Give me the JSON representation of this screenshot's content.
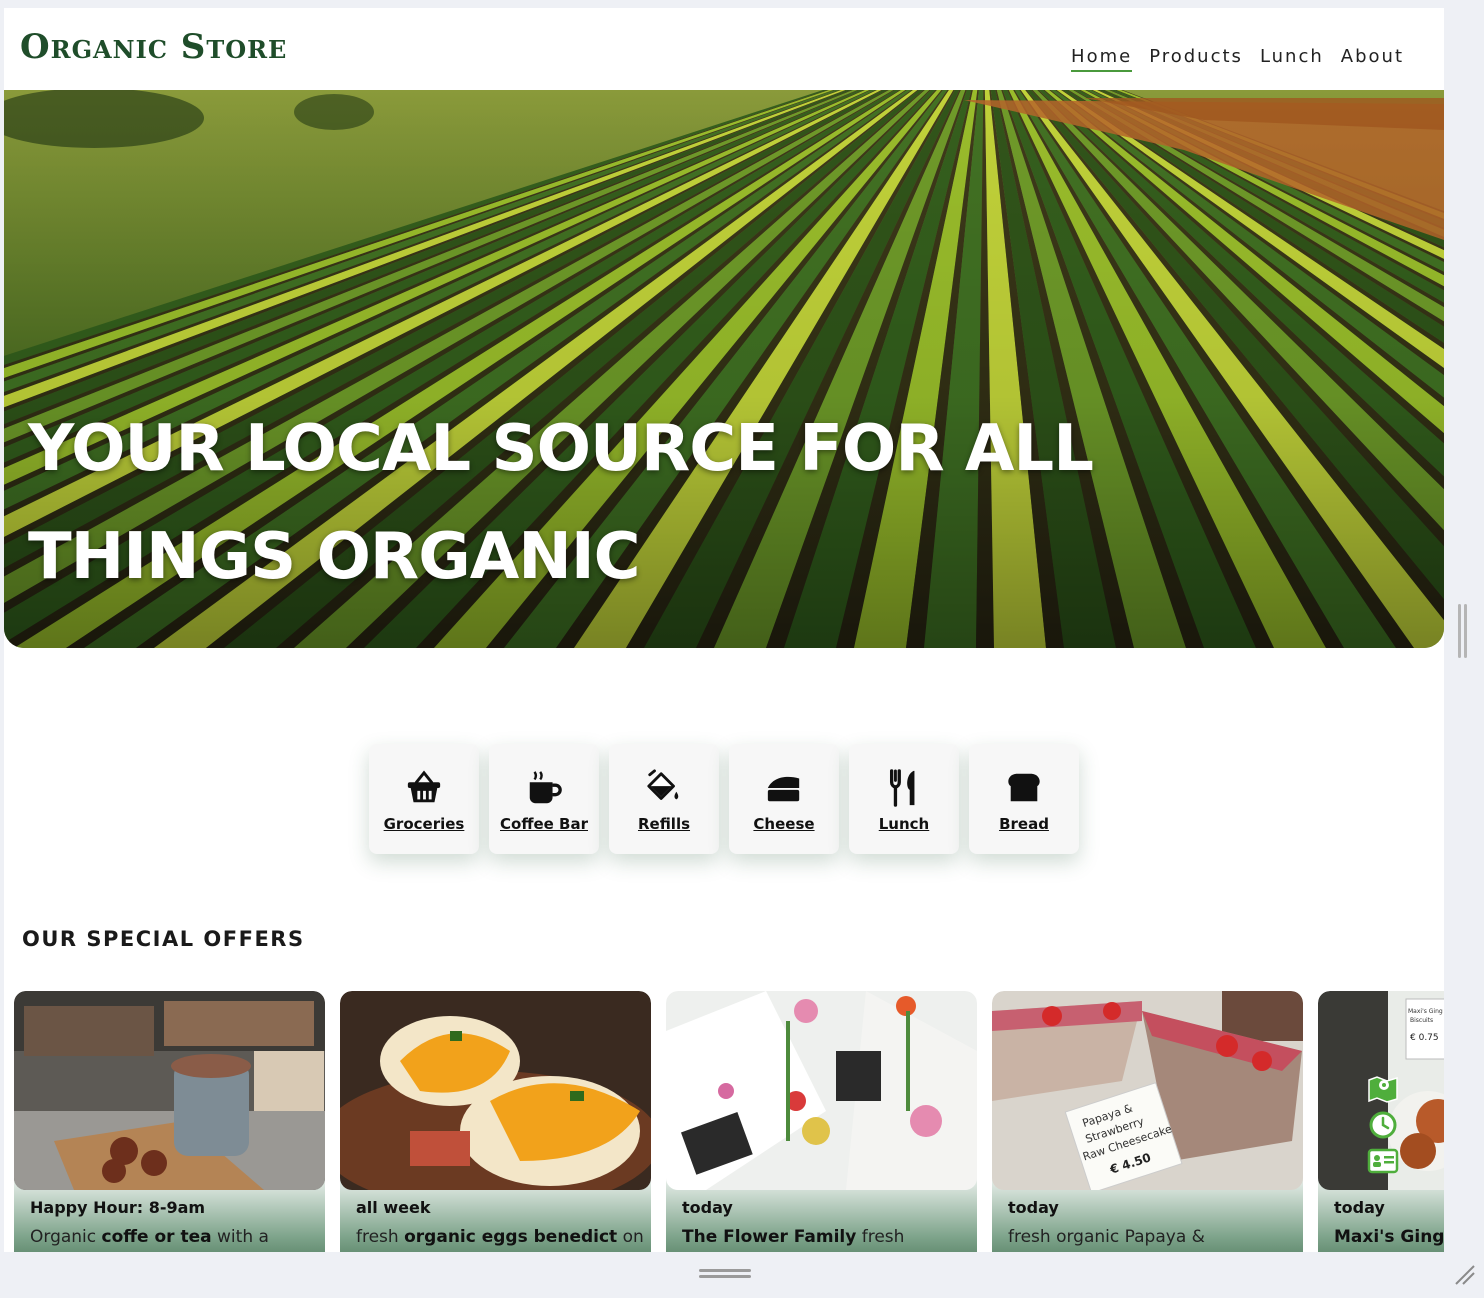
{
  "header": {
    "logo": "Organic Store",
    "nav": [
      "Home",
      "Products",
      "Lunch",
      "About"
    ],
    "active_nav": "Home"
  },
  "hero": {
    "title": "YOUR LOCAL SOURCE FOR ALL THINGS ORGANIC"
  },
  "categories": [
    {
      "label": "Groceries",
      "icon": "basket-icon"
    },
    {
      "label": "Coffee Bar",
      "icon": "coffee-cup-icon"
    },
    {
      "label": "Refills",
      "icon": "fill-bucket-icon"
    },
    {
      "label": "Cheese",
      "icon": "cheese-icon"
    },
    {
      "label": "Lunch",
      "icon": "utensils-icon"
    },
    {
      "label": "Bread",
      "icon": "bread-icon"
    }
  ],
  "offers_title": "OUR SPECIAL OFFERS",
  "offers": [
    {
      "when": "Happy Hour: 8-9am",
      "pre": "Organic ",
      "bold": "coffe or tea",
      "post": " with a"
    },
    {
      "when": "all week",
      "pre": "fresh ",
      "bold": "organic eggs benedict",
      "post": " on"
    },
    {
      "when": "today",
      "pre": "",
      "bold": "The Flower Family",
      "post": " fresh"
    },
    {
      "when": "today",
      "pre": "fresh organic Papaya &",
      "bold": "",
      "post": ""
    },
    {
      "when": "today",
      "pre": "",
      "bold": "Maxi's Ginge",
      "post": ""
    }
  ],
  "photo_texts": {
    "cheesecake_sign": [
      "Papaya &",
      "Strawberry",
      "Raw Cheesecake",
      "€ 4.50"
    ],
    "biscuit_sign": [
      "Maxi's Ging",
      "Biscuits",
      "€ 0.75"
    ]
  },
  "colors": {
    "brand_green": "#1f4d2a",
    "nav_underline": "#4a9a3c",
    "card_gradient_bottom": "#3e6b4d",
    "side_icon_green": "#4fae3c"
  }
}
